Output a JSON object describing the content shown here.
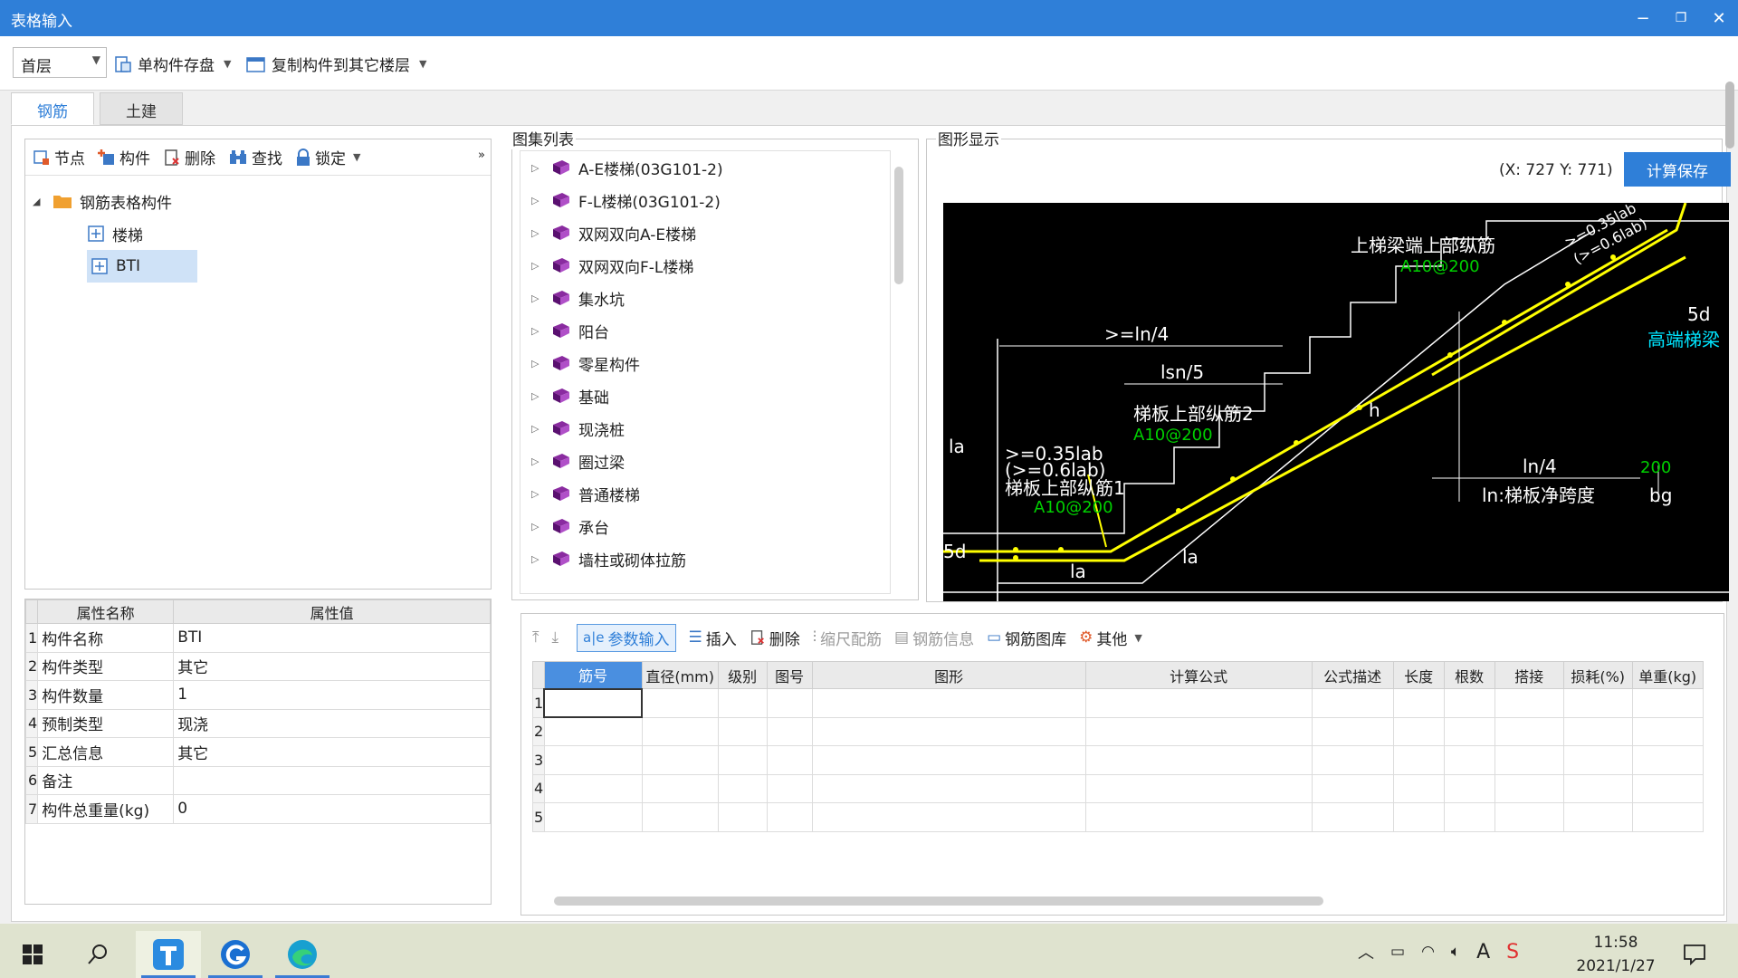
{
  "window": {
    "title": "表格输入",
    "minimize": "−",
    "restore": "❐",
    "close": "✕"
  },
  "toolbar": {
    "floor": "首层",
    "save_component": "单构件存盘",
    "copy_to_floor": "复制构件到其它楼层"
  },
  "tabs": [
    {
      "label": "钢筋"
    },
    {
      "label": "土建"
    }
  ],
  "left_toolbar": {
    "node": "节点",
    "component": "构件",
    "delete": "删除",
    "find": "查找",
    "lock": "锁定",
    "more": "»"
  },
  "tree": {
    "root": "钢筋表格构件",
    "children": [
      "楼梯",
      "BTI"
    ]
  },
  "properties": {
    "col_name": "属性名称",
    "col_value": "属性值",
    "rows": [
      {
        "idx": "1",
        "name": "构件名称",
        "value": "BTI"
      },
      {
        "idx": "2",
        "name": "构件类型",
        "value": "其它"
      },
      {
        "idx": "3",
        "name": "构件数量",
        "value": "1"
      },
      {
        "idx": "4",
        "name": "预制类型",
        "value": "现浇"
      },
      {
        "idx": "5",
        "name": "汇总信息",
        "value": "其它"
      },
      {
        "idx": "6",
        "name": "备注",
        "value": ""
      },
      {
        "idx": "7",
        "name": "构件总重量(kg)",
        "value": "0"
      }
    ]
  },
  "atlas": {
    "label": "图集列表",
    "items": [
      "A-E楼梯(03G101-2)",
      "F-L楼梯(03G101-2)",
      "双网双向A-E楼梯",
      "双网双向F-L楼梯",
      "集水坑",
      "阳台",
      "零星构件",
      "基础",
      "现浇桩",
      "圈过梁",
      "普通楼梯",
      "承台",
      "墙柱或砌体拉筋"
    ]
  },
  "graphic": {
    "label": "图形显示",
    "coord": "(X: 727 Y: 771)",
    "calc_save": "计算保存",
    "drawing": {
      "t_top_long": "上梯梁端上部纵筋",
      "t_top_long_spec": "A10@200",
      "t_len4": ">=ln/4",
      "t_lsn5": "lsn/5",
      "t_slab2": "梯板上部纵筋2",
      "t_slab2_spec": "A10@200",
      "t_la": "la",
      "t_035": ">=0.35lab",
      "t_061": "(>=0.6lab)",
      "t_slab1": "梯板上部纵筋1",
      "t_slab1_spec": "A10@200",
      "t_h": "h",
      "t_ln4": "ln/4",
      "t_200": "200",
      "t_net": "ln:梯板净跨度",
      "t_bg": "bg",
      "t_high_beam": "高端梯梁",
      "t_5d": "5d",
      "t_5d_left": "5d",
      "t_la2": "la",
      "t_la3": "la",
      "t_diag1": ">=0.35lab",
      "t_diag2": "(>=0.6lab)"
    }
  },
  "rebar_toolbar": {
    "param_input": "参数输入",
    "insert": "插入",
    "delete": "删除",
    "scale": "缩尺配筋",
    "info": "钢筋信息",
    "library": "钢筋图库",
    "other": "其他"
  },
  "rebar_table": {
    "headers": [
      "筋号",
      "直径(mm)",
      "级别",
      "图号",
      "图形",
      "计算公式",
      "公式描述",
      "长度",
      "根数",
      "搭接",
      "损耗(%)",
      "单重(kg)"
    ],
    "row_numbers": [
      "1",
      "2",
      "3",
      "4",
      "5"
    ]
  },
  "taskbar": {
    "time": "11:58",
    "date": "2021/1/27"
  },
  "colors": {
    "accent": "#2f7fd8",
    "yellow": "#ffff00",
    "green": "#00d000",
    "cyan": "#00e5ff"
  }
}
